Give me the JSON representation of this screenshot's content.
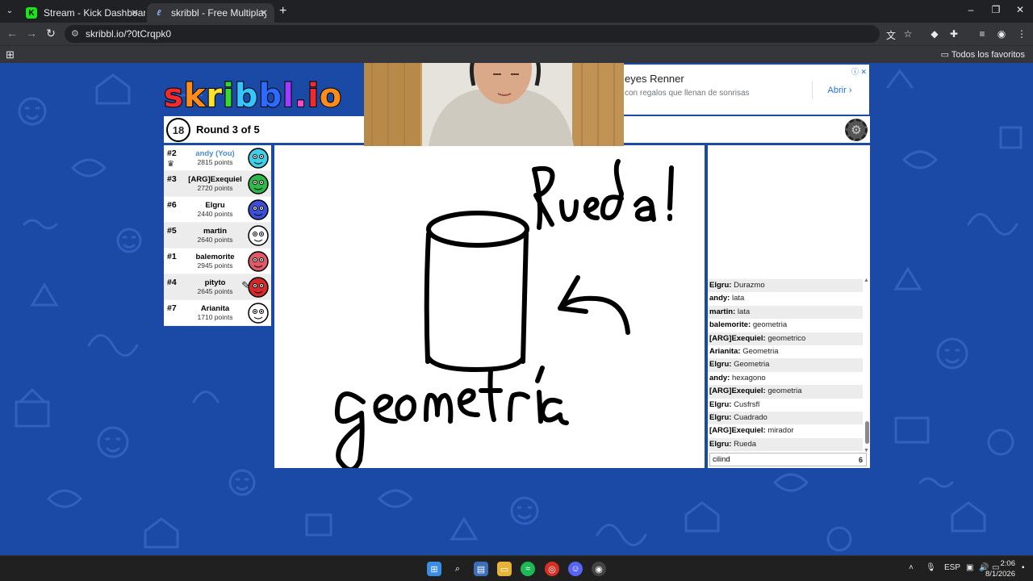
{
  "browser": {
    "tabs": [
      {
        "title": "Stream - Kick Dashboard",
        "favicon": "kick-icon",
        "active": false
      },
      {
        "title": "skribbl - Free Multiplayer Draw",
        "favicon": "skribbl-icon",
        "active": true
      }
    ],
    "url": "skribbl.io/?0tCrqpk0",
    "bookmarks_all": "Todos los favoritos"
  },
  "ad": {
    "title": "eyes Renner",
    "subtitle": "con regalos que llenan de sonrisas",
    "open_label": "Abrir",
    "open_icon": "chevron-right-icon"
  },
  "game": {
    "logo": "skribbl.io",
    "timer": "18",
    "round": "Round 3 of 5",
    "players": [
      {
        "rank": "#2",
        "name": "andy (You)",
        "points": "2815 points",
        "is_me": true,
        "crown": true,
        "avatar_color": "#3fd0e8"
      },
      {
        "rank": "#3",
        "name": "[ARG]Exequiel",
        "points": "2720 points",
        "is_me": false,
        "avatar_color": "#2fb84a"
      },
      {
        "rank": "#6",
        "name": "Elgru",
        "points": "2440 points",
        "is_me": false,
        "avatar_color": "#3b4fd6"
      },
      {
        "rank": "#5",
        "name": "martin",
        "points": "2640 points",
        "is_me": false,
        "avatar_color": "#ffffff"
      },
      {
        "rank": "#1",
        "name": "balemorite",
        "points": "2945 points",
        "is_me": false,
        "avatar_color": "#e05a68"
      },
      {
        "rank": "#4",
        "name": "pityto",
        "points": "2645 points",
        "is_me": false,
        "avatar_color": "#d42a2a",
        "drawing": true
      },
      {
        "rank": "#7",
        "name": "Arianita",
        "points": "1710 points",
        "is_me": false,
        "avatar_color": "#ffffff"
      }
    ],
    "canvas_text": {
      "word1": "Rueda!",
      "word2": "geometría"
    },
    "chat": [
      {
        "user": "Elgru:",
        "text": "Durazmo"
      },
      {
        "user": "andy:",
        "text": "lata"
      },
      {
        "user": "martin:",
        "text": "lata"
      },
      {
        "user": "balemorite:",
        "text": "geometria"
      },
      {
        "user": "[ARG]Exequiel:",
        "text": "geometrico"
      },
      {
        "user": "Arianita:",
        "text": "Geometria"
      },
      {
        "user": "Elgru:",
        "text": "Geometria"
      },
      {
        "user": "andy:",
        "text": "hexagono"
      },
      {
        "user": "[ARG]Exequiel:",
        "text": "geometria"
      },
      {
        "user": "Elgru:",
        "text": "Cusfrsfl"
      },
      {
        "user": "Elgru:",
        "text": "Cuadrado"
      },
      {
        "user": "[ARG]Exequiel:",
        "text": "mirador"
      },
      {
        "user": "Elgru:",
        "text": "Rueda"
      }
    ],
    "chat_input_value": "cilind",
    "chat_char_count": "6"
  },
  "taskbar": {
    "language": "ESP",
    "time": "2:06",
    "date": "8/1/2026"
  },
  "colors": {
    "page_bg": "#1b49a6",
    "browser_dark": "#202124",
    "me_name": "#4a8ad8"
  }
}
